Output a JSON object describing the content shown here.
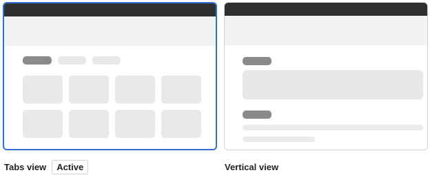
{
  "options": [
    {
      "label": "Tabs view",
      "selected": true,
      "badge": "Active",
      "accent": "#2f6fd1"
    },
    {
      "label": "Vertical view",
      "selected": false
    }
  ]
}
